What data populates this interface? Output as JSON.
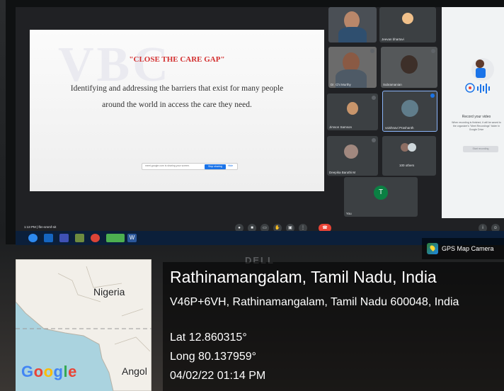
{
  "slide": {
    "watermark": "VBC",
    "title": "\"CLOSE THE CARE GAP\"",
    "body": "Identifying and addressing the barriers that exist for many people around the world in access the care they need.",
    "share_notice": "meet.google.com is sharing your screen.",
    "stop_sharing": "Stop sharing",
    "hide": "Hide"
  },
  "participants": [
    {
      "name": "",
      "initial": ""
    },
    {
      "name": "Jeevan bhartavi",
      "initial": ""
    },
    {
      "name": "Dr. Chi Murthy",
      "initial": ""
    },
    {
      "name": "Subramanian",
      "initial": ""
    },
    {
      "name": "Jimson Samson",
      "initial": ""
    },
    {
      "name": "vaishnavi Prashanth",
      "initial": ""
    },
    {
      "name": "Deepika Baruthi M",
      "initial": ""
    },
    {
      "name": "100 others",
      "initial": ""
    },
    {
      "name": "You",
      "initial": "T"
    }
  ],
  "panel": {
    "title": "Record your video",
    "description": "When recording is finished, it will be saved to the organizer's \"Meet Recordings\" folder in Google Drive",
    "button": "Start recording"
  },
  "meet_bar": {
    "time": "1:13 PM | fbn-smmf-nit"
  },
  "brand": "DELL",
  "gps": {
    "badge": "GPS Map Camera",
    "location": "Rathinamangalam, Tamil Nadu, India",
    "address": "V46P+6VH, Rathinamangalam, Tamil Nadu 600048, India",
    "lat": "Lat 12.860315°",
    "long": "Long 80.137959°",
    "datetime": "04/02/22 01:14 PM"
  },
  "map": {
    "label_nigeria": "Nigeria",
    "label_angola": "Angol",
    "google": "Google"
  },
  "colors": {
    "meet_red": "#ea4335",
    "meet_blue": "#1a73e8",
    "slide_title": "#d32f2f",
    "you_avatar": "#0b8043"
  }
}
